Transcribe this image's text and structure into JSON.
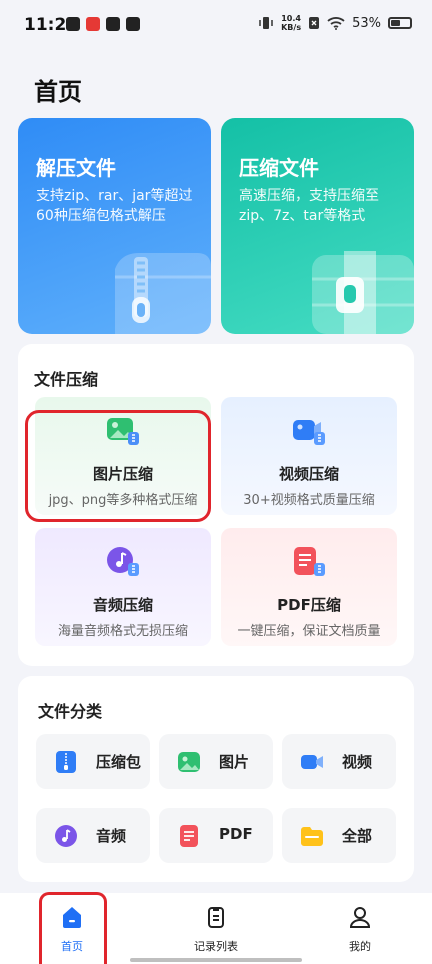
{
  "status_bar": {
    "time": "11:27",
    "speed_value": "10.4",
    "speed_unit": "KB/s",
    "battery_percent": "53%"
  },
  "page": {
    "title": "首页"
  },
  "hero_cards": {
    "unzip": {
      "title": "解压文件",
      "description": "支持zip、rar、jar等超过60种压缩包格式解压",
      "color": "#2f8cf6"
    },
    "zip": {
      "title": "压缩文件",
      "description": "高速压缩，支持压缩至zip、7z、tar等格式",
      "color": "#14c0a6"
    }
  },
  "compress_section": {
    "title": "文件压缩",
    "tiles": [
      {
        "name": "图片压缩",
        "desc": "jpg、png等多种格式压缩",
        "icon": "image-compress-icon"
      },
      {
        "name": "视频压缩",
        "desc": "30+视频格式质量压缩",
        "icon": "video-compress-icon"
      },
      {
        "name": "音频压缩",
        "desc": "海量音频格式无损压缩",
        "icon": "audio-compress-icon"
      },
      {
        "name": "PDF压缩",
        "desc": "一键压缩，保证文档质量",
        "icon": "pdf-compress-icon"
      }
    ]
  },
  "category_section": {
    "title": "文件分类",
    "items": [
      {
        "label": "压缩包",
        "icon": "archive-icon"
      },
      {
        "label": "图片",
        "icon": "image-icon"
      },
      {
        "label": "视频",
        "icon": "video-icon"
      },
      {
        "label": "音频",
        "icon": "audio-icon"
      },
      {
        "label": "PDF",
        "icon": "pdf-icon"
      },
      {
        "label": "全部",
        "icon": "folder-icon"
      }
    ]
  },
  "bottom_nav": {
    "items": [
      {
        "label": "首页",
        "active": true
      },
      {
        "label": "记录列表",
        "active": false
      },
      {
        "label": "我的",
        "active": false
      }
    ],
    "active_color": "#1f6ff5"
  },
  "highlight_color": "#e0252c"
}
